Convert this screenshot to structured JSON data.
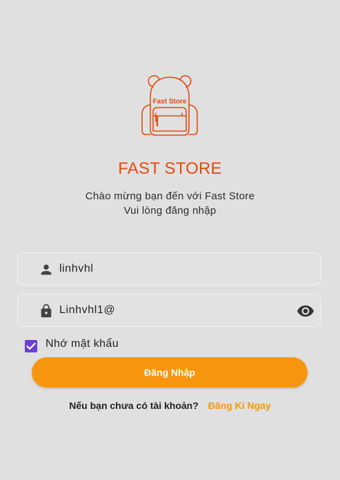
{
  "app": {
    "logo_text": "Fast Store",
    "title": "FAST STORE",
    "welcome_line1": "Chào mừng bạn đến với Fast Store",
    "welcome_line2": "Vui lòng đăng nhập"
  },
  "form": {
    "username_value": "linhvhl",
    "password_value": "Linhvhl1@",
    "remember_checked": true,
    "remember_label": "Nhớ mật khẩu",
    "login_label": "Đăng Nhập"
  },
  "signup": {
    "question": "Nếu bạn chưa có tài khoản?",
    "link_label": "Đăng Kí Ngay"
  },
  "icons": {
    "logo": "backpack-icon",
    "username": "person-icon",
    "password": "lock-icon",
    "visibility": "eye-icon",
    "checkbox": "checkmark-icon"
  },
  "colors": {
    "background": "#e0e0e0",
    "brand": "#e24a10",
    "accent": "#f7960e",
    "checkbox": "#6b3fd4"
  }
}
